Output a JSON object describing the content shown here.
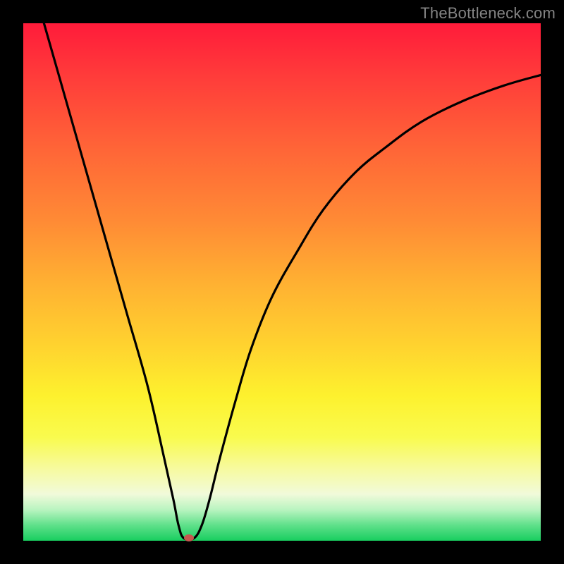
{
  "watermark": "TheBottleneck.com",
  "chart_data": {
    "type": "line",
    "title": "",
    "xlabel": "",
    "ylabel": "",
    "xlim": [
      0,
      100
    ],
    "ylim": [
      0,
      100
    ],
    "series": [
      {
        "name": "curve",
        "x": [
          4,
          8,
          12,
          16,
          20,
          24,
          27,
          29,
          30,
          31,
          33,
          34.5,
          36,
          38,
          41,
          44,
          48,
          53,
          58,
          64,
          70,
          77,
          85,
          93,
          100
        ],
        "y": [
          100,
          86,
          72,
          58,
          44,
          30,
          17,
          8,
          3,
          0.5,
          0.5,
          3,
          8,
          16,
          27,
          37,
          47,
          56,
          64,
          71,
          76,
          81,
          85,
          88,
          90
        ]
      }
    ],
    "marker": {
      "x": 32,
      "y": 0.5
    },
    "gradient_stops": [
      {
        "pos": 0,
        "color": "#ff1b3a"
      },
      {
        "pos": 50,
        "color": "#ffb032"
      },
      {
        "pos": 80,
        "color": "#f9fb4e"
      },
      {
        "pos": 100,
        "color": "#18ce5f"
      }
    ]
  }
}
